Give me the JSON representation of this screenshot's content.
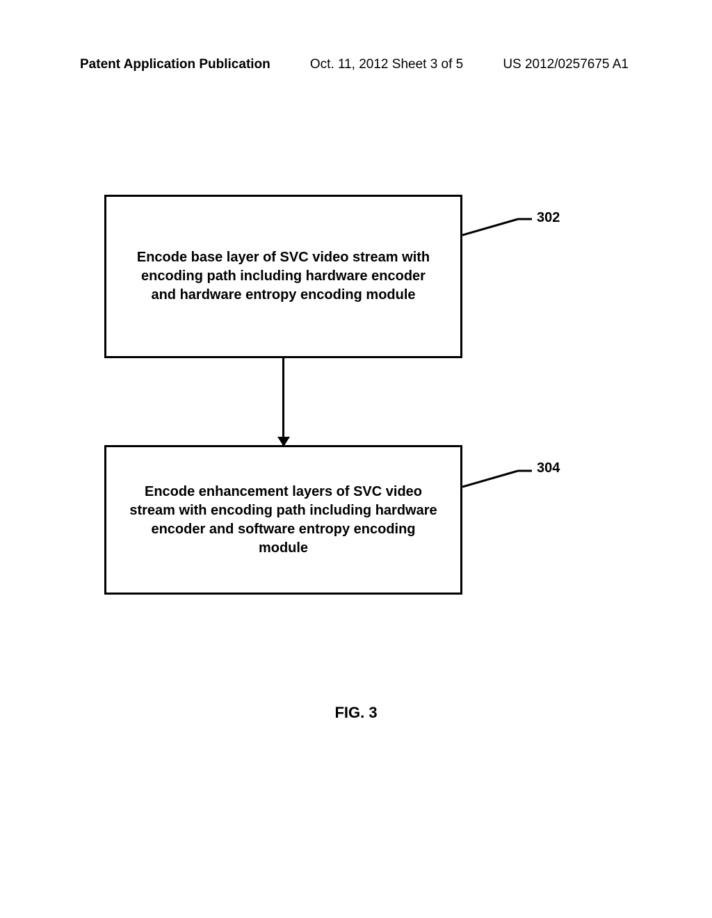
{
  "header": {
    "left": "Patent Application Publication",
    "center": "Oct. 11, 2012   Sheet 3 of 5",
    "right": "US 2012/0257675 A1"
  },
  "chart_data": {
    "type": "flowchart",
    "boxes": [
      {
        "id": "302",
        "label": "302",
        "text": "Encode base layer of SVC video stream with encoding path including hardware encoder and hardware entropy encoding module"
      },
      {
        "id": "304",
        "label": "304",
        "text": "Encode enhancement layers of SVC video stream with encoding path including hardware encoder and software entropy encoding module"
      }
    ],
    "connections": [
      {
        "from": "302",
        "to": "304"
      }
    ],
    "caption": "FIG. 3"
  }
}
